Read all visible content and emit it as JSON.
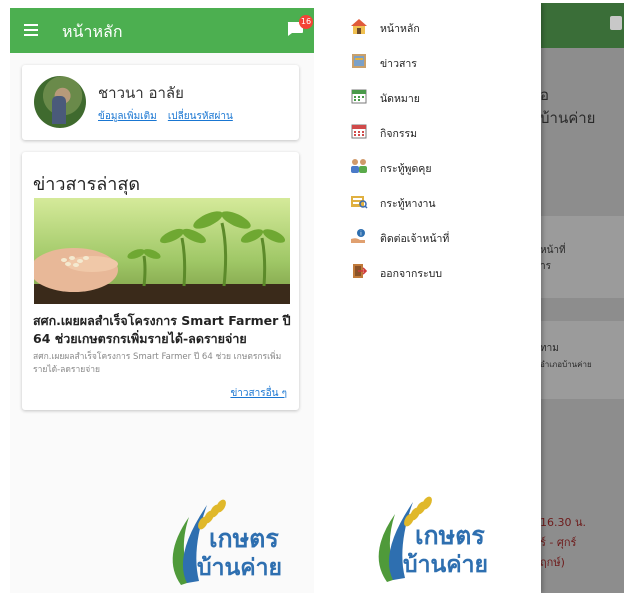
{
  "app": {
    "title": "หน้าหลัก",
    "notification_count": "16",
    "accent_color": "#4caf50"
  },
  "profile": {
    "name": "ชาวนา อาลัย",
    "more_info_link": "ข้อมูลเพิ่มเติม",
    "change_password_link": "เปลี่ยนรหัสผ่าน"
  },
  "news": {
    "heading": "ข่าวสารล่าสุด",
    "title": "สศก.เผยผลสำเร็จโครงการ Smart Farmer ปี 64 ช่วยเกษตรกรเพิ่มรายได้-ลดรายจ่าย",
    "description": "สศก.เผยผลสำเร็จโครงการ Smart Farmer ปี 64 ช่วย เกษตรกรเพิ่มรายได้-ลดรายจ่าย",
    "more_link": "ข่าวสารอื่น ๆ"
  },
  "logo": {
    "line1": "เกษตร",
    "line2": "บ้านค่าย"
  },
  "drawer": {
    "items": [
      {
        "label": "หน้าหลัก",
        "icon": "home-icon"
      },
      {
        "label": "ข่าวสาร",
        "icon": "news-icon"
      },
      {
        "label": "นัดหมาย",
        "icon": "calendar-icon"
      },
      {
        "label": "กิจกรรม",
        "icon": "activities-icon"
      },
      {
        "label": "กระทู้พูดคุย",
        "icon": "discussion-icon"
      },
      {
        "label": "กระทู้หางาน",
        "icon": "job-search-icon"
      },
      {
        "label": "ติดต่อเจ้าหน้าที่",
        "icon": "contact-staff-icon"
      },
      {
        "label": "ออกจากระบบ",
        "icon": "logout-icon"
      }
    ]
  },
  "background_fragments": {
    "t1": "อ",
    "t2": "บ้านค่าย",
    "t3": "หน้าที่",
    "t4": "าร",
    "t5": "ทาม",
    "t6": "อำเภอบ้านค่าย",
    "t7": "16.30 น.",
    "t8": "ร์ - ศุกร์",
    "t9": "ฤกษ์)"
  }
}
